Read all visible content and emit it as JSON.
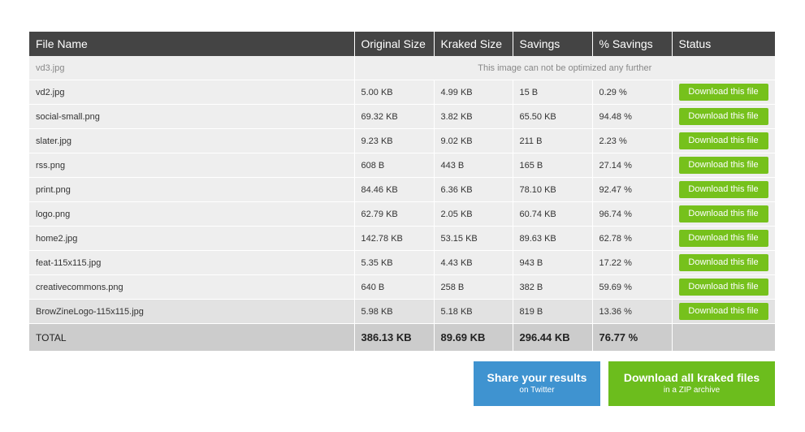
{
  "table": {
    "headers": {
      "file_name": "File Name",
      "original_size": "Original Size",
      "kraked_size": "Kraked Size",
      "savings": "Savings",
      "pct_savings": "% Savings",
      "status": "Status"
    },
    "failed_row": {
      "name": "vd3.jpg",
      "message": "This image can not be optimized any further"
    },
    "rows": [
      {
        "name": "vd2.jpg",
        "original": "5.00 KB",
        "kraked": "4.99 KB",
        "savings": "15 B",
        "pct": "0.29 %",
        "action": "Download this file"
      },
      {
        "name": "social-small.png",
        "original": "69.32 KB",
        "kraked": "3.82 KB",
        "savings": "65.50 KB",
        "pct": "94.48 %",
        "action": "Download this file"
      },
      {
        "name": "slater.jpg",
        "original": "9.23 KB",
        "kraked": "9.02 KB",
        "savings": "211 B",
        "pct": "2.23 %",
        "action": "Download this file"
      },
      {
        "name": "rss.png",
        "original": "608 B",
        "kraked": "443 B",
        "savings": "165 B",
        "pct": "27.14 %",
        "action": "Download this file"
      },
      {
        "name": "print.png",
        "original": "84.46 KB",
        "kraked": "6.36 KB",
        "savings": "78.10 KB",
        "pct": "92.47 %",
        "action": "Download this file"
      },
      {
        "name": "logo.png",
        "original": "62.79 KB",
        "kraked": "2.05 KB",
        "savings": "60.74 KB",
        "pct": "96.74 %",
        "action": "Download this file"
      },
      {
        "name": "home2.jpg",
        "original": "142.78 KB",
        "kraked": "53.15 KB",
        "savings": "89.63 KB",
        "pct": "62.78 %",
        "action": "Download this file"
      },
      {
        "name": "feat-115x115.jpg",
        "original": "5.35 KB",
        "kraked": "4.43 KB",
        "savings": "943 B",
        "pct": "17.22 %",
        "action": "Download this file"
      },
      {
        "name": "creativecommons.png",
        "original": "640 B",
        "kraked": "258 B",
        "savings": "382 B",
        "pct": "59.69 %",
        "action": "Download this file"
      },
      {
        "name": "BrowZineLogo-115x115.jpg",
        "original": "5.98 KB",
        "kraked": "5.18 KB",
        "savings": "819 B",
        "pct": "13.36 %",
        "action": "Download this file"
      }
    ],
    "total": {
      "label": "TOTAL",
      "original": "386.13 KB",
      "kraked": "89.69 KB",
      "savings": "296.44 KB",
      "pct": "76.77 %"
    }
  },
  "actions": {
    "share": {
      "main": "Share your results",
      "sub": "on Twitter"
    },
    "zip": {
      "main": "Download all kraked files",
      "sub": "in a ZIP archive"
    }
  },
  "colors": {
    "header_bg": "#444444",
    "row_bg": "#eeeeee",
    "total_bg": "#cccccc",
    "download_green": "#76c11c",
    "share_blue": "#3f93d0",
    "zip_green": "#6cbd1d"
  }
}
